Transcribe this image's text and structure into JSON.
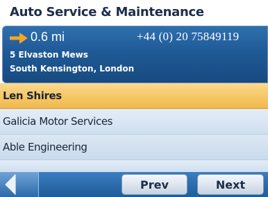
{
  "title": "Auto Service & Maintenance",
  "selected": {
    "distance": "0.6 mi",
    "phone": "+44 (0) 20 75849119",
    "address_line1": "5 Elvaston Mews",
    "address_line2": "South Kensington, London",
    "direction_icon": "arrow-right-icon"
  },
  "results": [
    {
      "name": "Len Shires",
      "selected": true
    },
    {
      "name": "Galicia Motor Services",
      "selected": false
    },
    {
      "name": "Able Engineering",
      "selected": false
    }
  ],
  "toolbar": {
    "back_icon": "back-arrow-icon",
    "prev_label": "Prev",
    "next_label": "Next"
  },
  "colors": {
    "header_blue": "#1f5a97",
    "selected_row": "#f6c766",
    "row_blue": "#d6e4f2",
    "direction_arrow": "#f5a623"
  }
}
